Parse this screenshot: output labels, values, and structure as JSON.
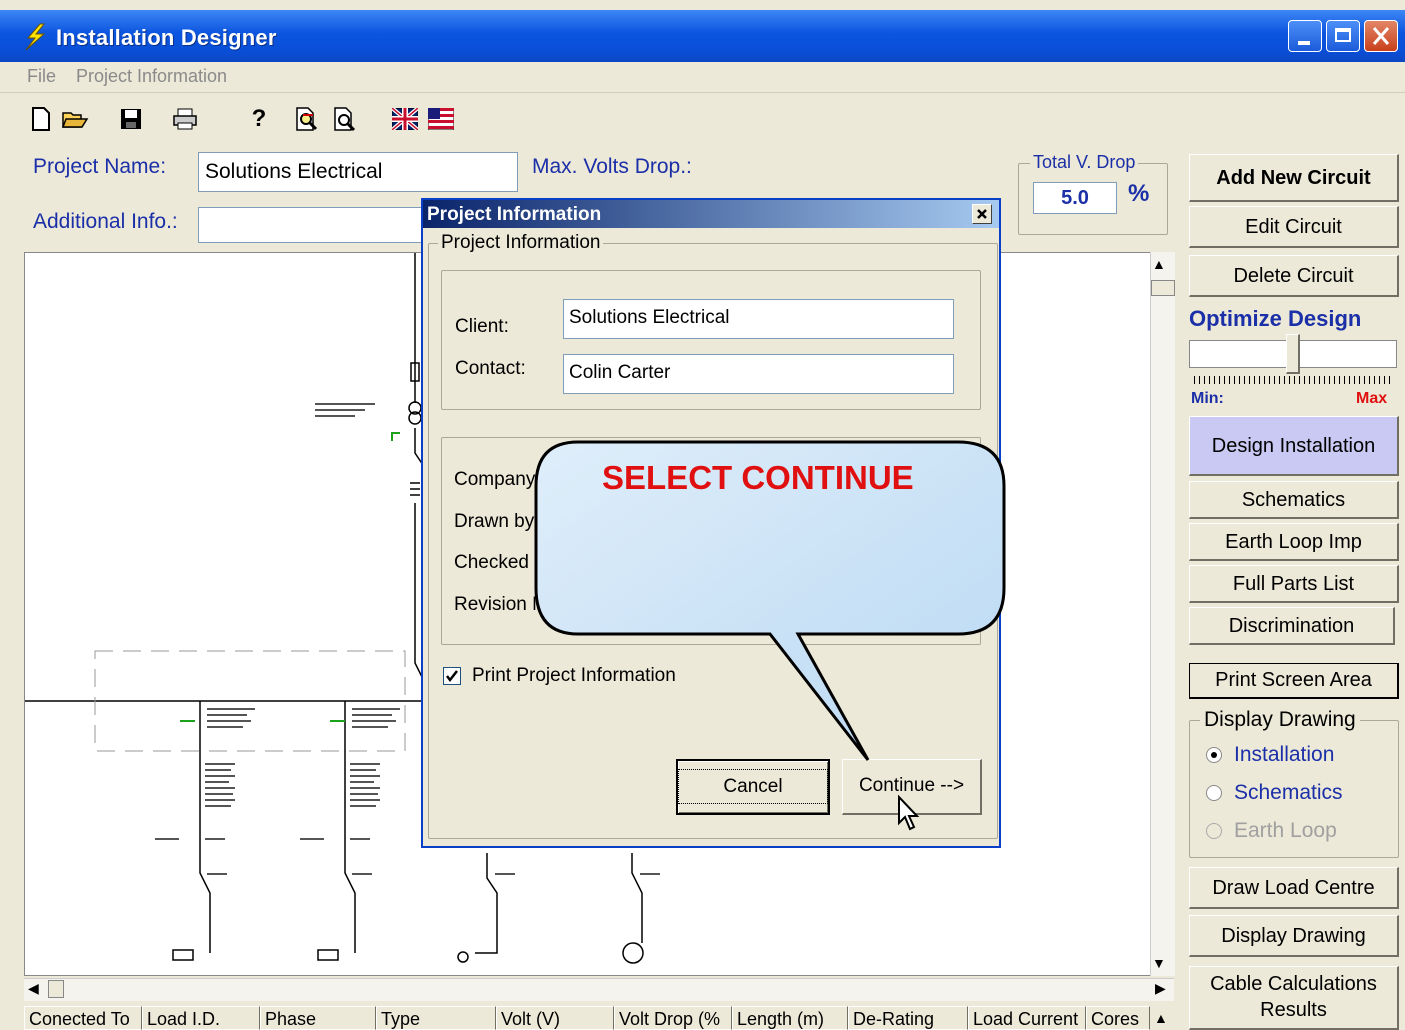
{
  "window": {
    "title": "Installation Designer"
  },
  "menu": [
    "File",
    "Project Information"
  ],
  "toolbar": {
    "icons": [
      "new-document-icon",
      "open-folder-icon",
      "save-icon",
      "print-icon",
      "help-icon",
      "print-preview-icon",
      "preview-page-icon",
      "uk-flag-icon",
      "us-flag-icon"
    ]
  },
  "header": {
    "project_name_label": "Project Name:",
    "project_name_value": "Solutions Electrical",
    "additional_info_label": "Additional Info.:",
    "max_volts_drop_label": "Max. Volts Drop.:",
    "total_v_drop_label": "Total V. Drop",
    "total_v_drop_value": "5.0",
    "total_v_drop_unit": "%"
  },
  "sidebar": {
    "add_new_circuit": "Add New Circuit",
    "edit_circuit": "Edit Circuit",
    "delete_circuit": "Delete Circuit",
    "optimize_design": "Optimize Design",
    "slider_min": "Min:",
    "slider_max": "Max",
    "optimize_level": 0.5,
    "design_installation": "Design Installation",
    "schematics": "Schematics",
    "earth_loop_imp": "Earth Loop Imp",
    "full_parts_list": "Full Parts List",
    "discrimination": "Discrimination",
    "print_screen_area": "Print Screen Area",
    "display_drawing_group": "Display Drawing",
    "radio_installation": "Installation",
    "radio_schematics": "Schematics",
    "radio_earth_loop": "Earth Loop",
    "draw_load_centre": "Draw Load Centre",
    "display_drawing": "Display Drawing",
    "cable_calc_line1": "Cable Calculations",
    "cable_calc_line2": "Results"
  },
  "dialog": {
    "title": "Project Information",
    "group_label": "Project Information",
    "client_label": "Client:",
    "client_value": "Solutions Electrical",
    "contact_label": "Contact:",
    "contact_value": "Colin Carter",
    "company_label": "Company",
    "drawn_by_label": "Drawn by:",
    "checked_label": "Checked",
    "revision_label": "Revision N",
    "print_project_info": "Print Project Information",
    "cancel": "Cancel",
    "continue": "Continue -->"
  },
  "callout": {
    "text": "SELECT CONTINUE"
  },
  "status_columns": [
    "Conected To",
    "Load I.D.",
    "Phase",
    "Type",
    "Volt (V)",
    "Volt Drop (%",
    "Length (m)",
    "De-Rating",
    "Load Current",
    "Cores"
  ]
}
